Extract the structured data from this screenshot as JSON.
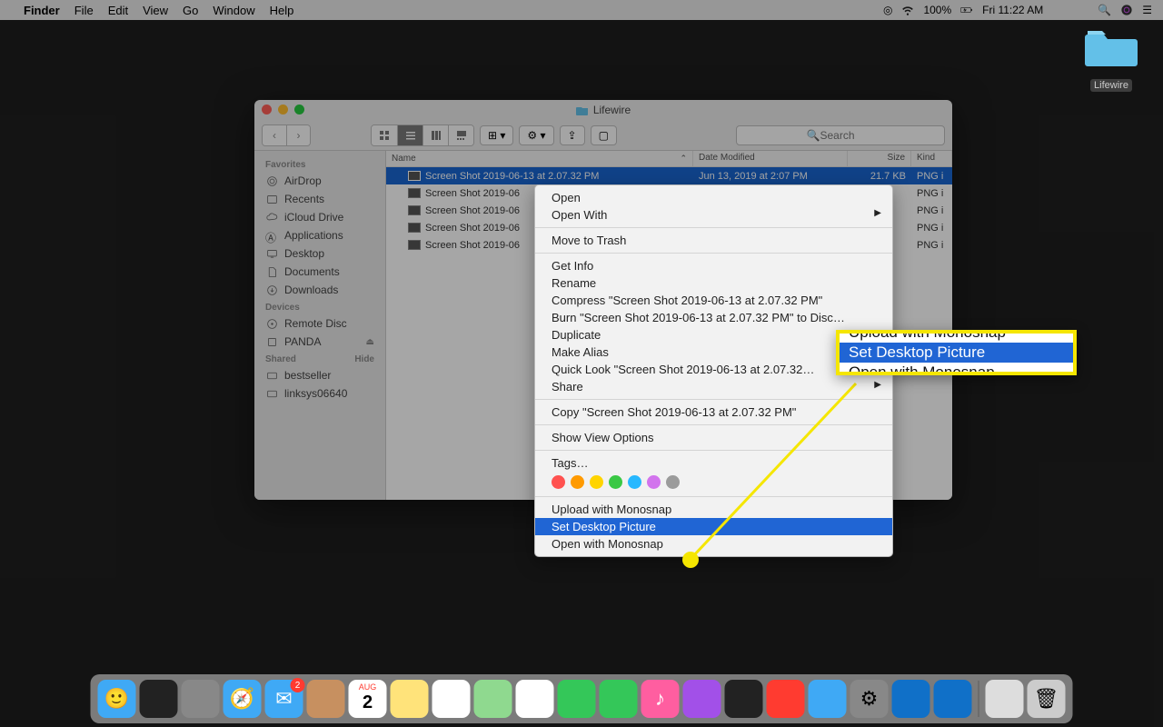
{
  "menubar": {
    "app": "Finder",
    "items": [
      "File",
      "Edit",
      "View",
      "Go",
      "Window",
      "Help"
    ],
    "battery": "100%",
    "clock": "Fri 11:22 AM"
  },
  "desktop": {
    "folder_label": "Lifewire"
  },
  "finder": {
    "title": "Lifewire",
    "search_placeholder": "Search",
    "sidebar": {
      "favorites_heading": "Favorites",
      "favorites": [
        "AirDrop",
        "Recents",
        "iCloud Drive",
        "Applications",
        "Desktop",
        "Documents",
        "Downloads"
      ],
      "devices_heading": "Devices",
      "devices": [
        "Remote Disc",
        "PANDA"
      ],
      "shared_heading": "Shared",
      "shared_hide": "Hide",
      "shared": [
        "bestseller",
        "linksys06640"
      ]
    },
    "columns": {
      "name": "Name",
      "date": "Date Modified",
      "size": "Size",
      "kind": "Kind"
    },
    "rows": [
      {
        "name": "Screen Shot 2019-06-13 at 2.07.32 PM",
        "date": "Jun 13, 2019 at 2:07 PM",
        "size": "21.7 KB",
        "kind": "PNG i",
        "selected": true
      },
      {
        "name": "Screen Shot 2019-06",
        "date": "",
        "size": "",
        "kind": "PNG i"
      },
      {
        "name": "Screen Shot 2019-06",
        "date": "",
        "size": "",
        "kind": "PNG i"
      },
      {
        "name": "Screen Shot 2019-06",
        "date": "",
        "size": "",
        "kind": "PNG i"
      },
      {
        "name": "Screen Shot 2019-06",
        "date": "",
        "size": "",
        "kind": "PNG i"
      }
    ]
  },
  "ctxmenu": {
    "open": "Open",
    "open_with": "Open With",
    "trash": "Move to Trash",
    "get_info": "Get Info",
    "rename": "Rename",
    "compress": "Compress \"Screen Shot 2019-06-13 at 2.07.32 PM\"",
    "burn": "Burn \"Screen Shot 2019-06-13 at 2.07.32 PM\" to Disc…",
    "duplicate": "Duplicate",
    "make_alias": "Make Alias",
    "quick_look": "Quick Look \"Screen Shot 2019-06-13 at 2.07.32…",
    "share": "Share",
    "copy": "Copy \"Screen Shot 2019-06-13 at 2.07.32 PM\"",
    "view_options": "Show View Options",
    "tags_label": "Tags…",
    "upload_monosnap": "Upload with Monosnap",
    "set_desktop": "Set Desktop Picture",
    "open_monosnap": "Open with Monosnap",
    "tag_colors": [
      "#ff5250",
      "#ff9a00",
      "#ffd400",
      "#3ac845",
      "#27b8ff",
      "#d274ed",
      "#9b9b9b"
    ]
  },
  "callout": {
    "upload": "Upload with Monosnap",
    "set_desktop": "Set Desktop Picture",
    "open": "Open with Monosnap"
  },
  "dock": {
    "apps": [
      "finder",
      "siri",
      "launchpad",
      "safari",
      "mail",
      "contacts",
      "calendar",
      "notes",
      "reminders",
      "maps",
      "photos",
      "messages",
      "facetime",
      "itunes",
      "podcasts",
      "tv",
      "news",
      "appstore",
      "settings",
      "outlook",
      "word"
    ],
    "calendar_day": "2",
    "mail_badge": "2",
    "right": [
      "files",
      "trash"
    ]
  }
}
